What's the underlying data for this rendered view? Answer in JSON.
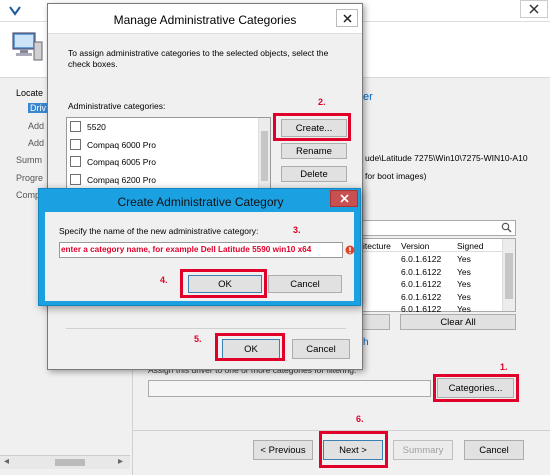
{
  "wizard": {
    "nav_items": [
      "Locate",
      "Driv",
      "Add",
      "Add",
      "Summ",
      "Progre",
      "Comp"
    ],
    "link_text": "er",
    "path_text": "ude\\Latitude 7275\\Win10\\7275-WIN10-A10",
    "boot_text": "for boot images)",
    "table": {
      "headers": [
        "itecture",
        "Version",
        "Signed"
      ],
      "rows": [
        [
          "",
          "6.0.1.6122",
          "Yes"
        ],
        [
          "",
          "6.0.1.6122",
          "Yes"
        ],
        [
          "",
          "6.0.1.6122",
          "Yes"
        ],
        [
          "",
          "6.0.1.6122",
          "Yes"
        ],
        [
          "",
          "6.0.1.6122",
          "Yes"
        ]
      ]
    },
    "clear_all_label": "Clear All",
    "link_h_text": "h",
    "assign_text": "Assign this driver to one or more categories for filtering.",
    "categories_label": "Categories...",
    "previous_label": "< Previous",
    "next_label": "Next >",
    "summary_label": "Summary",
    "cancel_label": "Cancel"
  },
  "manage_dialog": {
    "title": "Manage Administrative Categories",
    "description": "To assign administrative categories to the selected objects, select the check boxes.",
    "categories_label": "Administrative categories:",
    "items": [
      "5520",
      "Compaq 6000 Pro",
      "Compaq 6005 Pro",
      "Compaq 6200 Pro"
    ],
    "create_label": "Create...",
    "rename_label": "Rename",
    "delete_label": "Delete",
    "ok_label": "OK",
    "cancel_label": "Cancel"
  },
  "create_dialog": {
    "title": "Create Administrative Category",
    "prompt": "Specify the name of the new administrative category:",
    "input_value": "enter a category name, for example Dell Latitude 5590 win10 x64",
    "ok_label": "OK",
    "cancel_label": "Cancel"
  },
  "annotations": {
    "step1": "1.",
    "step2": "2.",
    "step3": "3.",
    "step4": "4.",
    "step5": "5.",
    "step6": "6."
  },
  "colors": {
    "annotation_red": "#e0002a",
    "dialog_blue_border": "#1ba1e2",
    "link_blue": "#0066cc"
  }
}
